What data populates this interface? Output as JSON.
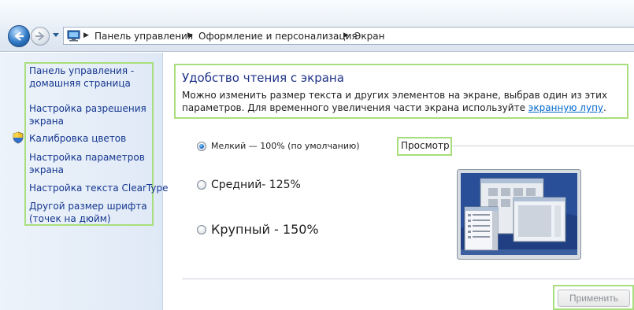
{
  "address_bar": {
    "crumbs": [
      "Панель управления",
      "Оформление и персонализация",
      "Экран"
    ]
  },
  "tasks": {
    "home": "Панель управления - домашняя страница",
    "items": [
      "Настройка разрешения экрана",
      "Калибровка цветов",
      "Настройка параметров экрана",
      "Настройка текста ClearType",
      "Другой размер шрифта (точек на дюйм)"
    ]
  },
  "main": {
    "title": "Удобство чтения с экрана",
    "description": "Можно изменить размер текста и других элементов на экране, выбрав один из этих параметров. Для временного увеличения части экрана используйте",
    "link": "экранную лупу",
    "period": "."
  },
  "options": [
    {
      "label": "Мелкий — 100% (по умолчанию)",
      "selected": true
    },
    {
      "label": "Средний- 125%",
      "selected": false
    },
    {
      "label": "Крупный - 150%",
      "selected": false
    }
  ],
  "preview": {
    "label": "Просмотр"
  },
  "apply_button": {
    "label": "Применить",
    "enabled": false
  },
  "colors": {
    "highlight": "#a9de7d",
    "link": "#0066cc",
    "title": "#1e3287"
  },
  "icons": [
    "back-arrow-icon",
    "forward-arrow-icon",
    "control-panel-icon",
    "uac-shield-icon",
    "chevron-right-icon"
  ]
}
